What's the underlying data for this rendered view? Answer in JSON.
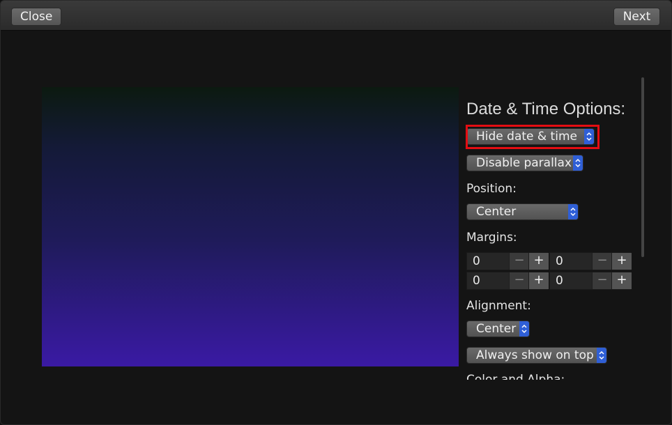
{
  "titlebar": {
    "close_label": "Close",
    "next_label": "Next"
  },
  "panel": {
    "heading": "Date & Time Options:",
    "hide_select": "Hide date & time",
    "parallax_select": "Disable parallax",
    "position_label": "Position:",
    "position_select": "Center",
    "margins_label": "Margins:",
    "margins": [
      "0",
      "0",
      "0",
      "0"
    ],
    "spin_minus": "−",
    "spin_plus": "+",
    "alignment_label": "Alignment:",
    "alignment_select": "Center",
    "ontop_select": "Always show on top",
    "color_label": "Color and Alpha:"
  },
  "icons": {
    "select_arrow": "up-down-chevron-icon"
  },
  "colors": {
    "highlight": "#e40d12",
    "select_arrow_bg": "#2f5fd6"
  }
}
